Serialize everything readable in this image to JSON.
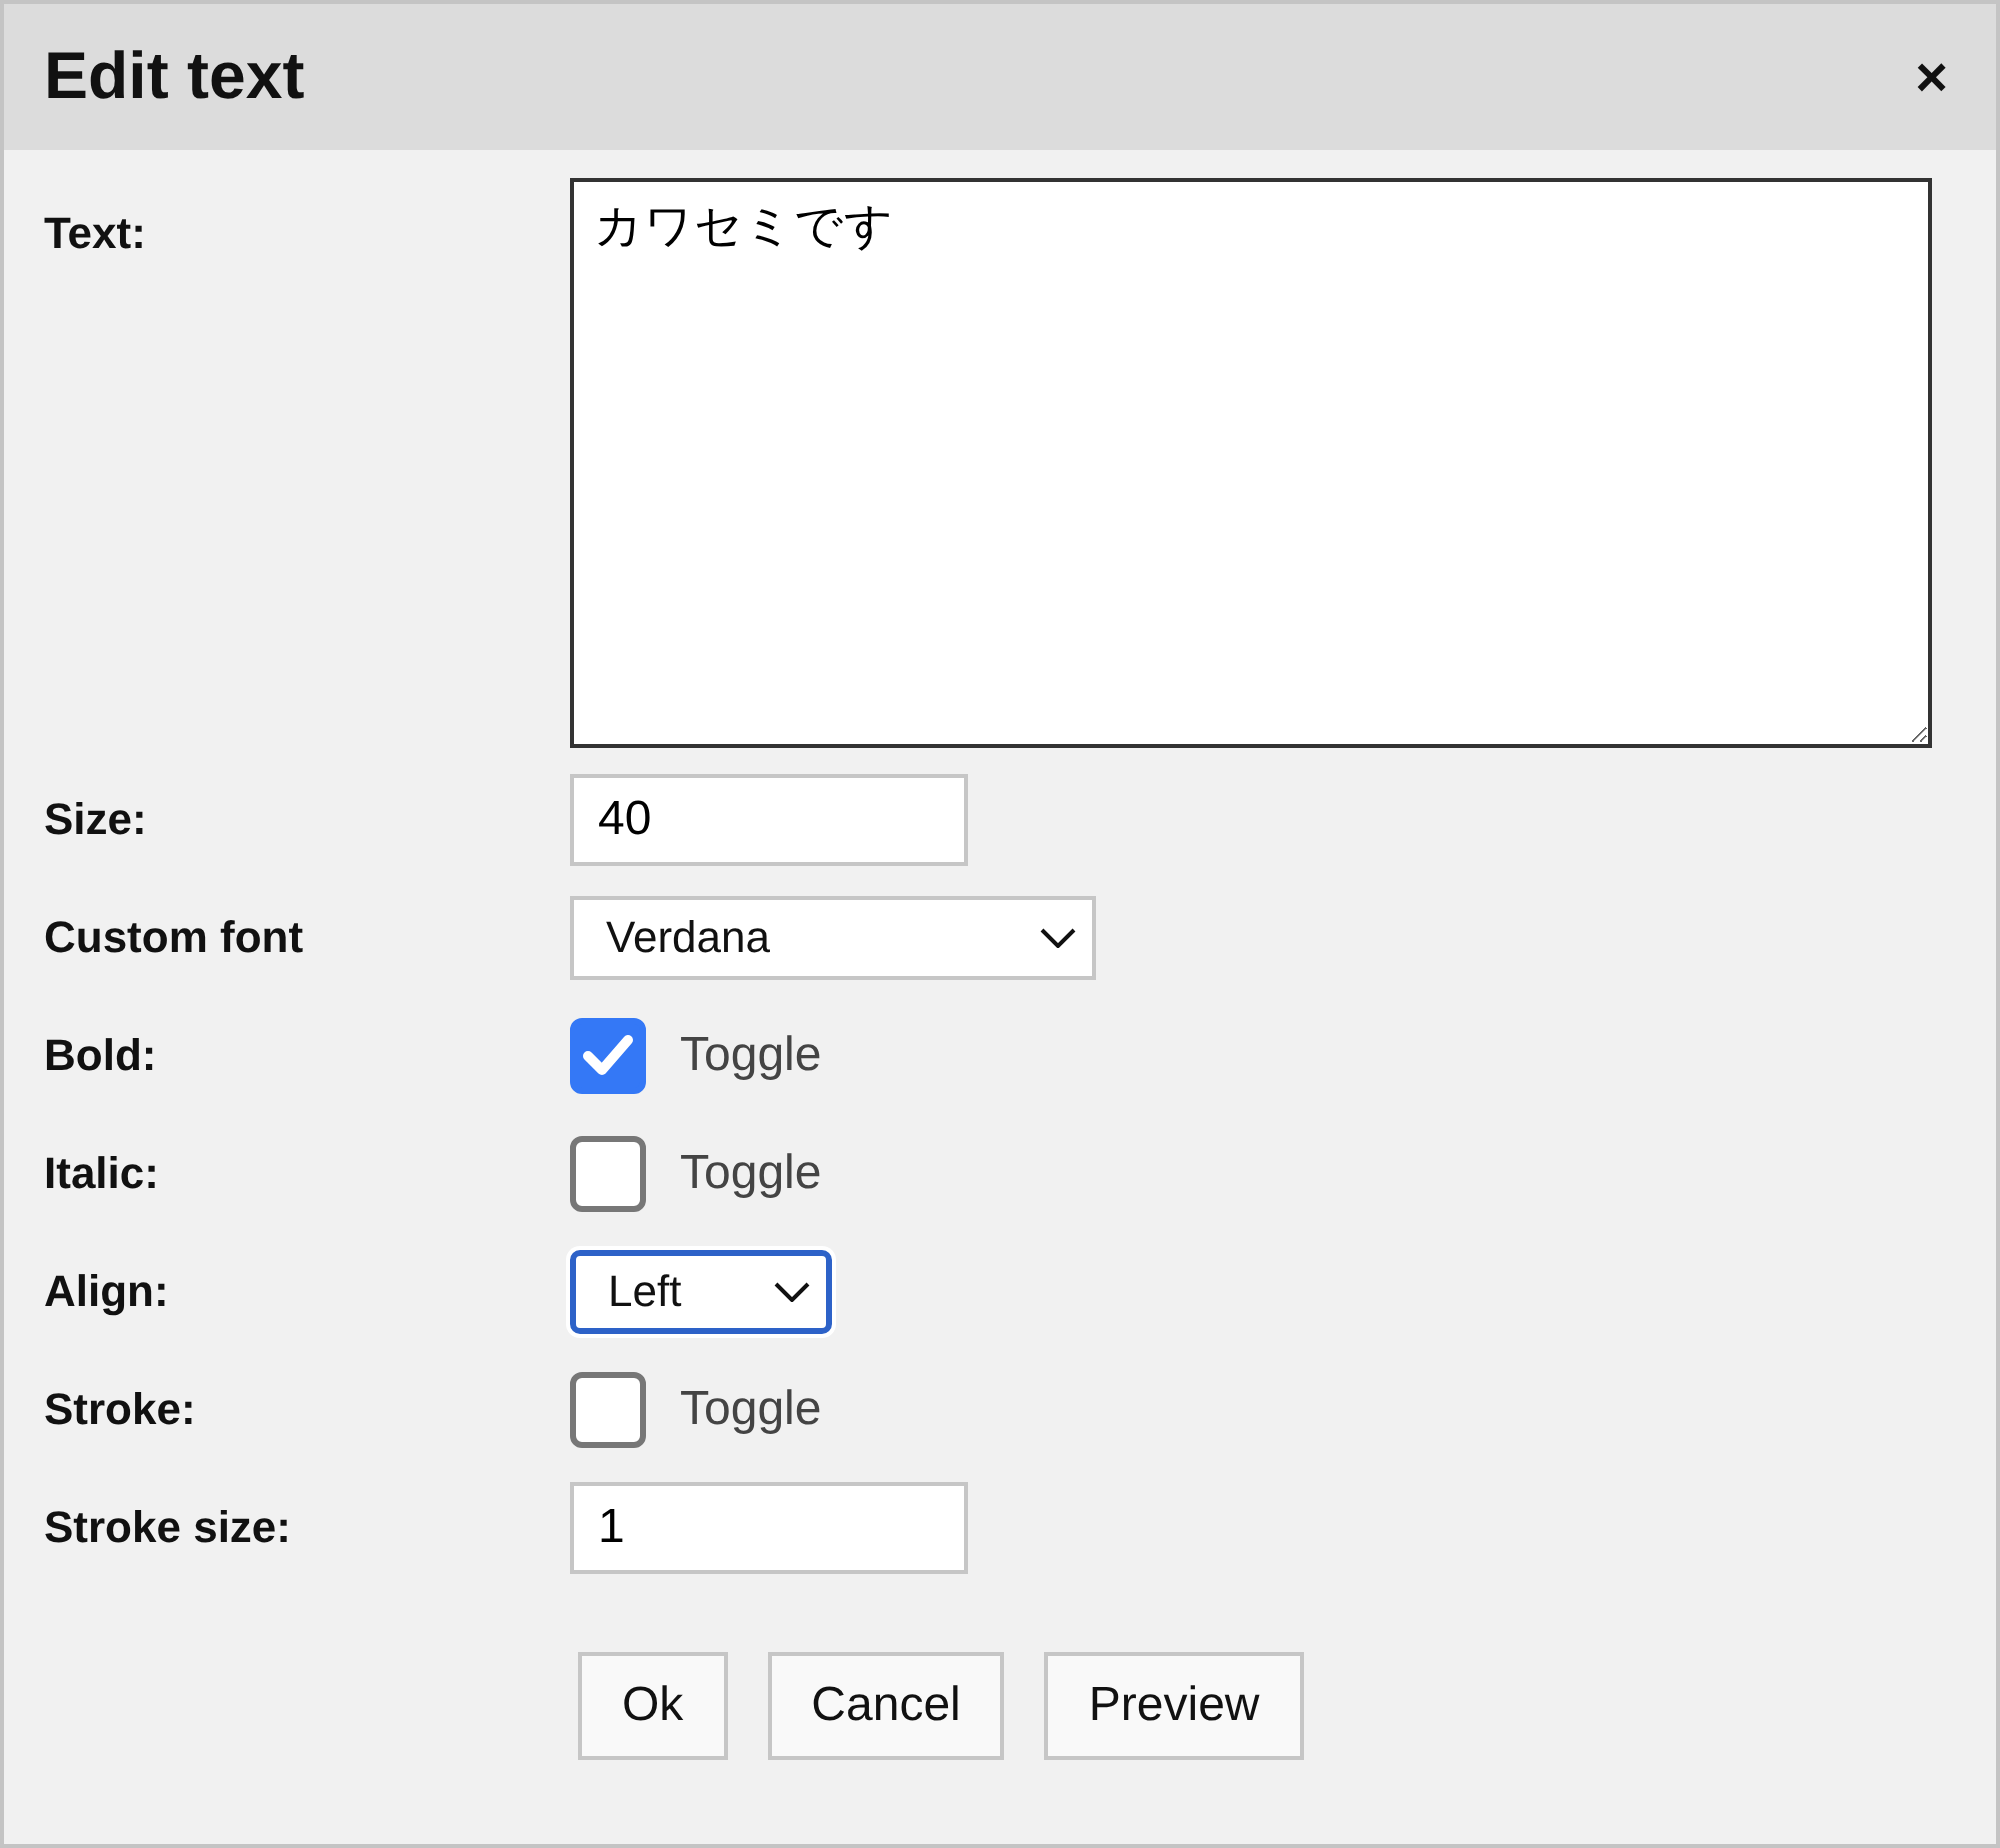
{
  "dialog": {
    "title": "Edit text",
    "close": "×"
  },
  "fields": [
    {
      "kind": "textarea",
      "label": "Text:",
      "value": "カワセミです"
    },
    {
      "kind": "input",
      "label": "Size:",
      "value": "40"
    },
    {
      "kind": "select",
      "label": "Custom font",
      "value": "Verdana",
      "focused": false,
      "wide": true
    },
    {
      "kind": "checkbox",
      "label": "Bold:",
      "text": "Toggle",
      "checked": true
    },
    {
      "kind": "checkbox",
      "label": "Italic:",
      "text": "Toggle",
      "checked": false
    },
    {
      "kind": "select",
      "label": "Align:",
      "value": "Left",
      "focused": true,
      "wide": false
    },
    {
      "kind": "checkbox",
      "label": "Stroke:",
      "text": "Toggle",
      "checked": false
    },
    {
      "kind": "input",
      "label": "Stroke size:",
      "value": "1"
    }
  ],
  "buttons": [
    "Ok",
    "Cancel",
    "Preview"
  ]
}
